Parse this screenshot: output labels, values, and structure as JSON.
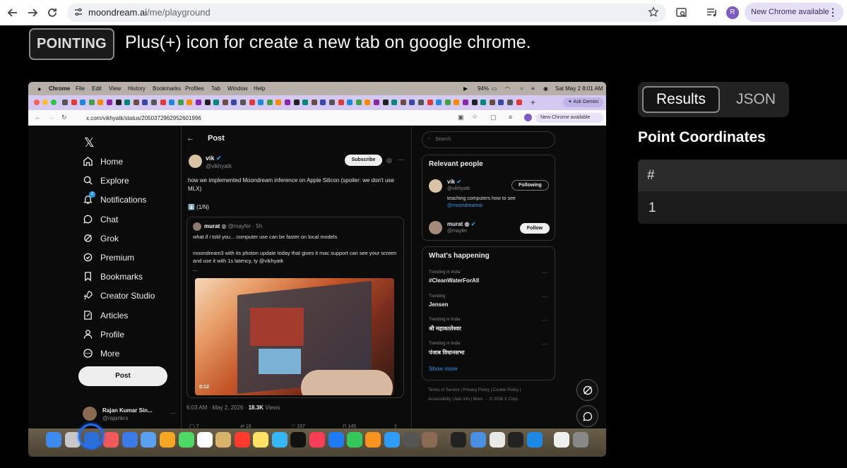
{
  "browser": {
    "url_host": "moondream.ai",
    "url_path": "/me/playground",
    "profile_initial": "R",
    "update_label": "New Chrome available"
  },
  "playground": {
    "mode_label": "POINTING",
    "prompt": "Plus(+) icon for create a new tab on google chrome.",
    "tabs": [
      "Results",
      "JSON"
    ],
    "section_title": "Point Coordinates",
    "table_header": "#",
    "table_rows": [
      "1"
    ]
  },
  "screenshot": {
    "menubar": {
      "app": "Chrome",
      "items": [
        "File",
        "Edit",
        "View",
        "History",
        "Bookmarks",
        "Profiles",
        "Tab",
        "Window",
        "Help"
      ],
      "battery": "94%",
      "datetime": "Sat May 2  8:01 AM"
    },
    "ask_gemini": "Ask Gemini",
    "url": "x.com/vikhyatk/status/2050372962952601996",
    "update_label": "New Chrome available",
    "nav": [
      "Home",
      "Explore",
      "Notifications",
      "Chat",
      "Grok",
      "Premium",
      "Bookmarks",
      "Creator Studio",
      "Articles",
      "Profile",
      "More"
    ],
    "notif_count": "2",
    "post_button": "Post",
    "account": {
      "name": "Rajan Kumar Sin...",
      "handle": "@rajankrx"
    },
    "column_title": "Post",
    "tweet": {
      "name": "vik",
      "handle": "@vikhyatk",
      "subscribe": "Subscribe",
      "text": "how we implemented Moondream inference on Apple Silicon (spoiler: we don't use MLX)",
      "thread": "⬇️ (1/N)",
      "quote_name": "murat",
      "quote_meta": "@mayfer · 5h",
      "quote_text1": "what if i told you... computer use can be faster on local models",
      "quote_text2": "moondream3 with its photon update today that gives it mac support can see your screen and use it with 1s latency, ty @vikhyatk",
      "quote_text3": "...",
      "video_time": "0:12",
      "time": "6:03 AM · May 2, 2026 · ",
      "views": "18.3K",
      "views_label": " Views",
      "replies": "7",
      "reposts": "16",
      "likes": "197",
      "bookmarks": "145"
    },
    "search_placeholder": "Search",
    "relevant_title": "Relevant people",
    "people": [
      {
        "name": "vik",
        "handle": "@vikhyatk",
        "bio": "teaching computers how to see",
        "bio_link": "@moondreamai",
        "button": "Following"
      },
      {
        "name": "murat",
        "handle": "@mayfer",
        "button": "Follow"
      }
    ],
    "happening_title": "What's happening",
    "trends": [
      {
        "caption": "Trending in India",
        "title": "#CleanWaterForAll"
      },
      {
        "caption": "Trending",
        "title": "Jensen"
      },
      {
        "caption": "Trending in India",
        "title": "श्री महाकालेश्वर"
      },
      {
        "caption": "Trending in India",
        "title": "पंजाब विधानसभा"
      }
    ],
    "show_more": "Show more",
    "footer1": "Terms of Service  |  Privacy Policy  |  Cookie Policy  |",
    "footer2": "Accessibility  |  Ads info  |  More ···  © 2026 X Corp."
  }
}
